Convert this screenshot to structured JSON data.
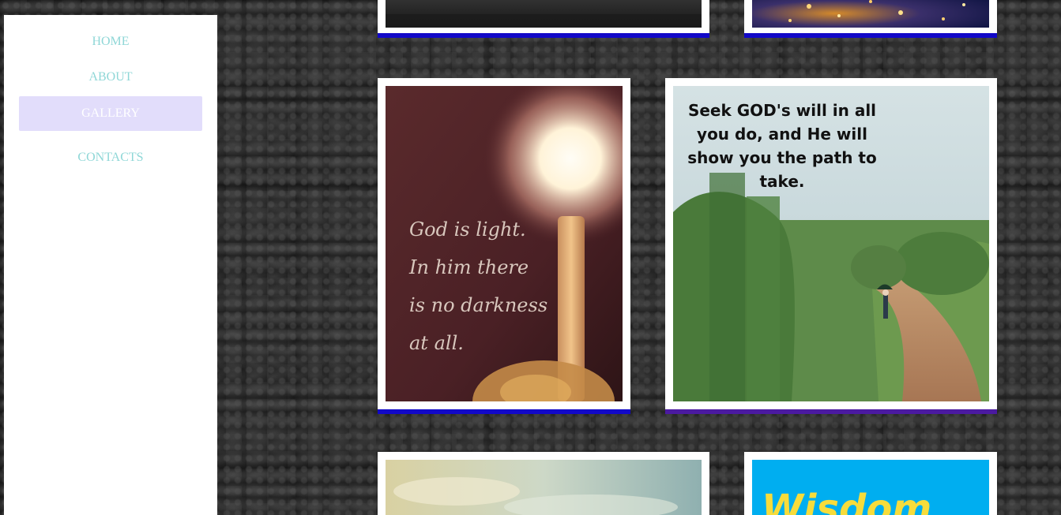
{
  "nav": {
    "items": [
      {
        "label": "HOME"
      },
      {
        "label": "ABOUT"
      },
      {
        "label": "GALLERY"
      },
      {
        "label": "CONTACTS"
      }
    ],
    "active_index": 2,
    "colors": {
      "link": "#8fd7d7",
      "active_bg": "#e2ddfb",
      "active_text": "#ffffff"
    }
  },
  "gallery": {
    "images": [
      {
        "name": "dark-landscape-image",
        "text": ""
      },
      {
        "name": "bokeh-lights-image",
        "text": ""
      },
      {
        "name": "candle-image",
        "lines": [
          "God is light.",
          "In him there",
          "is no darkness",
          "at all."
        ]
      },
      {
        "name": "path-image",
        "lines": [
          "Seek GOD's will in all",
          "you do, and He will",
          "show you the path to",
          "take."
        ]
      },
      {
        "name": "sky-image",
        "text": ""
      },
      {
        "name": "wisdom-image",
        "text": "Wisdom"
      }
    ],
    "accent_colors": {
      "frame_bottom_blue": "#1208c8",
      "frame_bottom_purple": "#4b1aa0",
      "wisdom_bg": "#00aef0",
      "wisdom_text": "#f7dc3b"
    }
  }
}
